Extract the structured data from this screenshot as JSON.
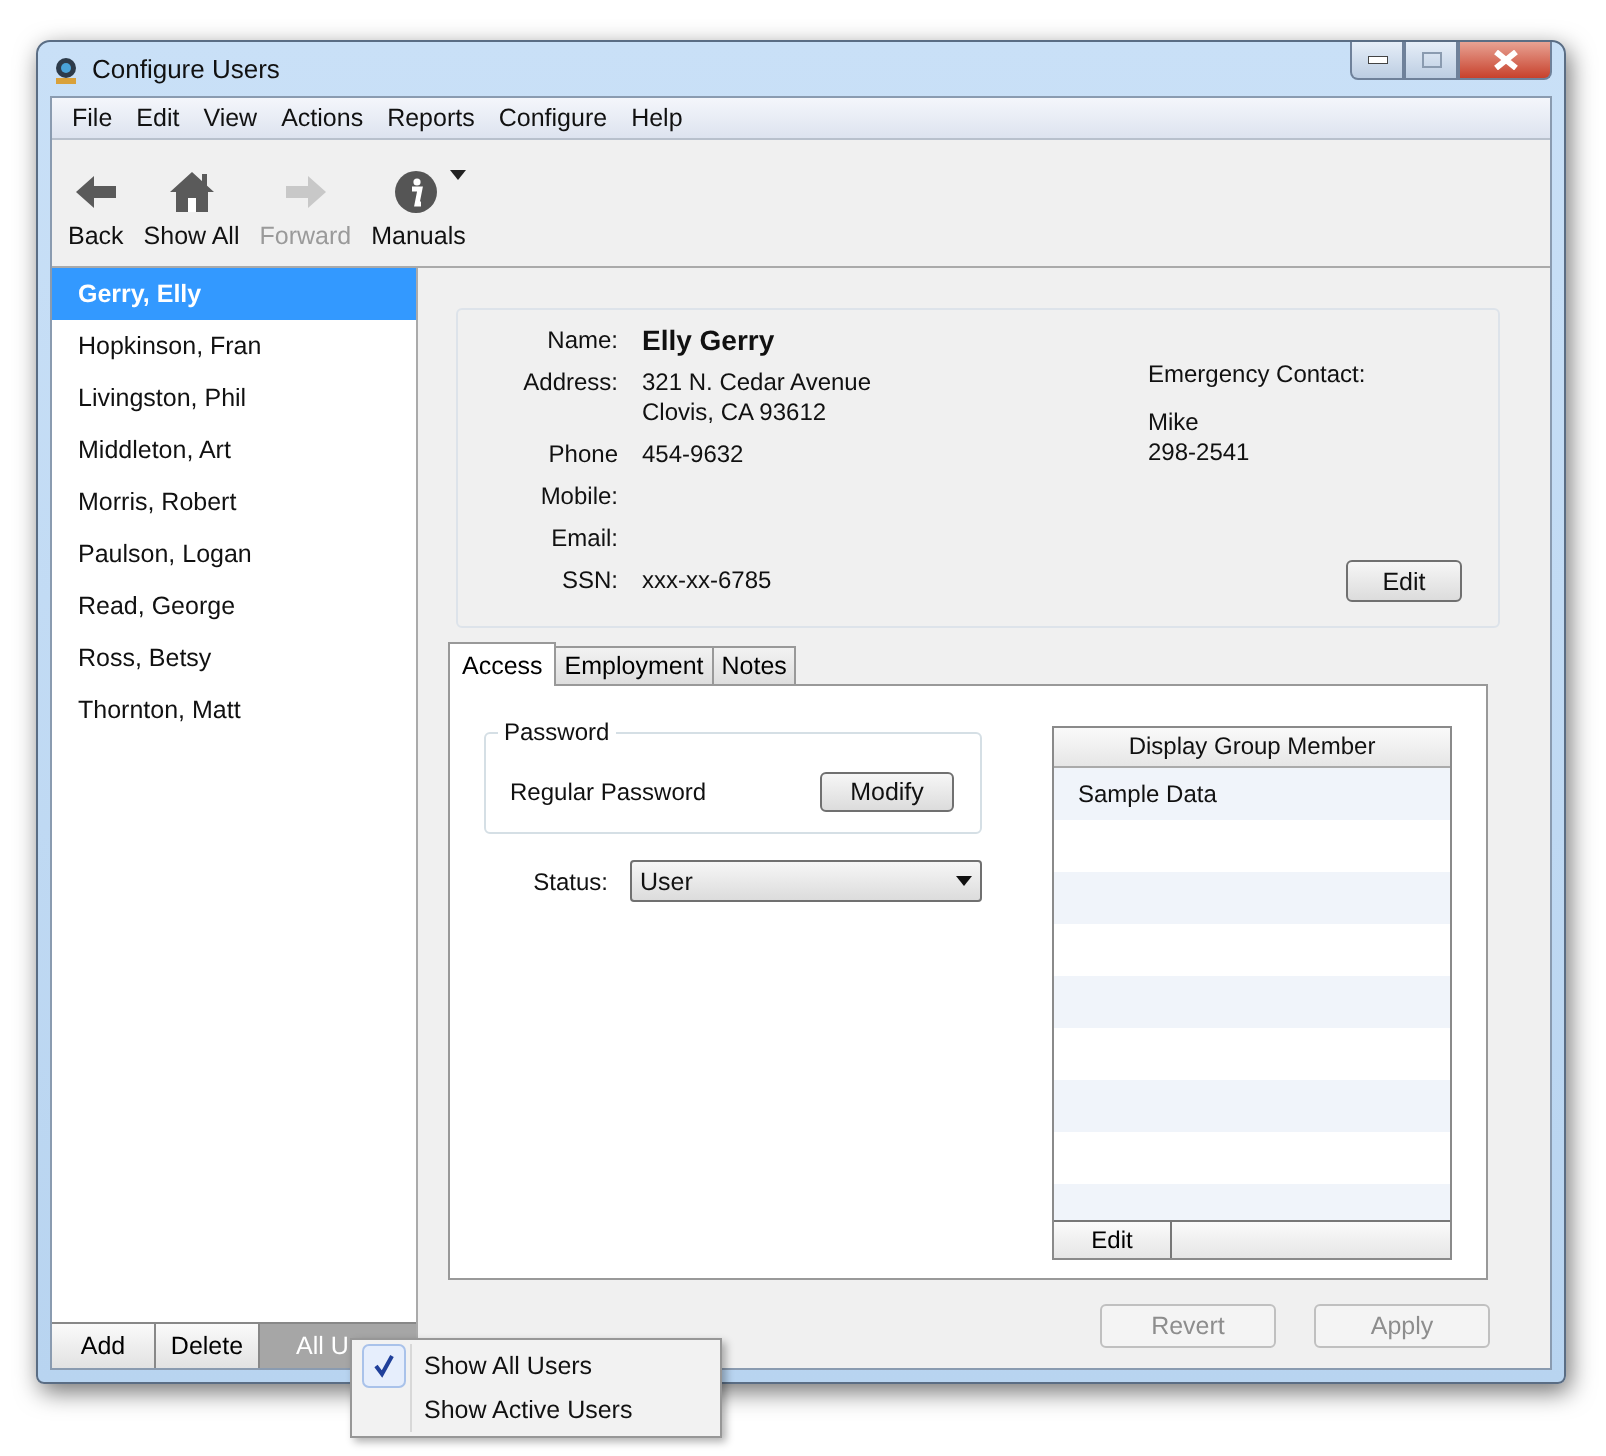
{
  "window": {
    "title": "Configure Users"
  },
  "menu": [
    "File",
    "Edit",
    "View",
    "Actions",
    "Reports",
    "Configure",
    "Help"
  ],
  "toolbar": [
    {
      "label": "Back",
      "kind": "back",
      "disabled": false,
      "has_menu": false
    },
    {
      "label": "Show All",
      "kind": "home",
      "disabled": false,
      "has_menu": false
    },
    {
      "label": "Forward",
      "kind": "forward",
      "disabled": true,
      "has_menu": false
    },
    {
      "label": "Manuals",
      "kind": "info",
      "disabled": false,
      "has_menu": true
    }
  ],
  "users": [
    {
      "name": "Gerry, Elly",
      "selected": true
    },
    {
      "name": "Hopkinson, Fran",
      "selected": false
    },
    {
      "name": "Livingston, Phil",
      "selected": false
    },
    {
      "name": "Middleton, Art",
      "selected": false
    },
    {
      "name": "Morris, Robert",
      "selected": false
    },
    {
      "name": "Paulson, Logan",
      "selected": false
    },
    {
      "name": "Read, George",
      "selected": false
    },
    {
      "name": "Ross, Betsy",
      "selected": false
    },
    {
      "name": "Thornton, Matt",
      "selected": false
    }
  ],
  "sidebar_buttons": [
    "Add",
    "Delete"
  ],
  "filter_button": "All U",
  "filter_menu": [
    {
      "label": "Show All Users",
      "checked": true
    },
    {
      "label": "Show Active Users",
      "checked": false
    }
  ],
  "details": {
    "fields": [
      {
        "label": "Name:",
        "kind": "name",
        "lines": [
          "Elly Gerry"
        ]
      },
      {
        "label": "Address:",
        "kind": "text",
        "lines": [
          "321 N. Cedar Avenue",
          "Clovis, CA 93612"
        ]
      },
      {
        "label": "Phone",
        "kind": "text",
        "lines": [
          "454-9632"
        ]
      },
      {
        "label": "Mobile:"
      },
      {
        "label": "Email:"
      },
      {
        "label": "SSN:",
        "kind": "text",
        "lines": [
          "xxx-xx-6785"
        ]
      }
    ],
    "emergency": {
      "label": "Emergency Contact:",
      "lines": [
        "Mike",
        "298-2541"
      ]
    },
    "edit_button": "Edit"
  },
  "tabs": [
    {
      "label": "Access",
      "selected": true
    },
    {
      "label": "Employment",
      "selected": false
    },
    {
      "label": "Notes",
      "selected": false
    }
  ],
  "access": {
    "password_group": {
      "title": "Password",
      "label": "Regular Password",
      "button": "Modify"
    },
    "status": {
      "label": "Status:",
      "value": "User"
    },
    "group_table": {
      "column": "Display Group Member",
      "rows": [
        "Sample Data"
      ],
      "footer_button": "Edit"
    }
  },
  "buttons": [
    {
      "label": "Revert",
      "disabled": true
    },
    {
      "label": "Apply",
      "disabled": true
    }
  ]
}
